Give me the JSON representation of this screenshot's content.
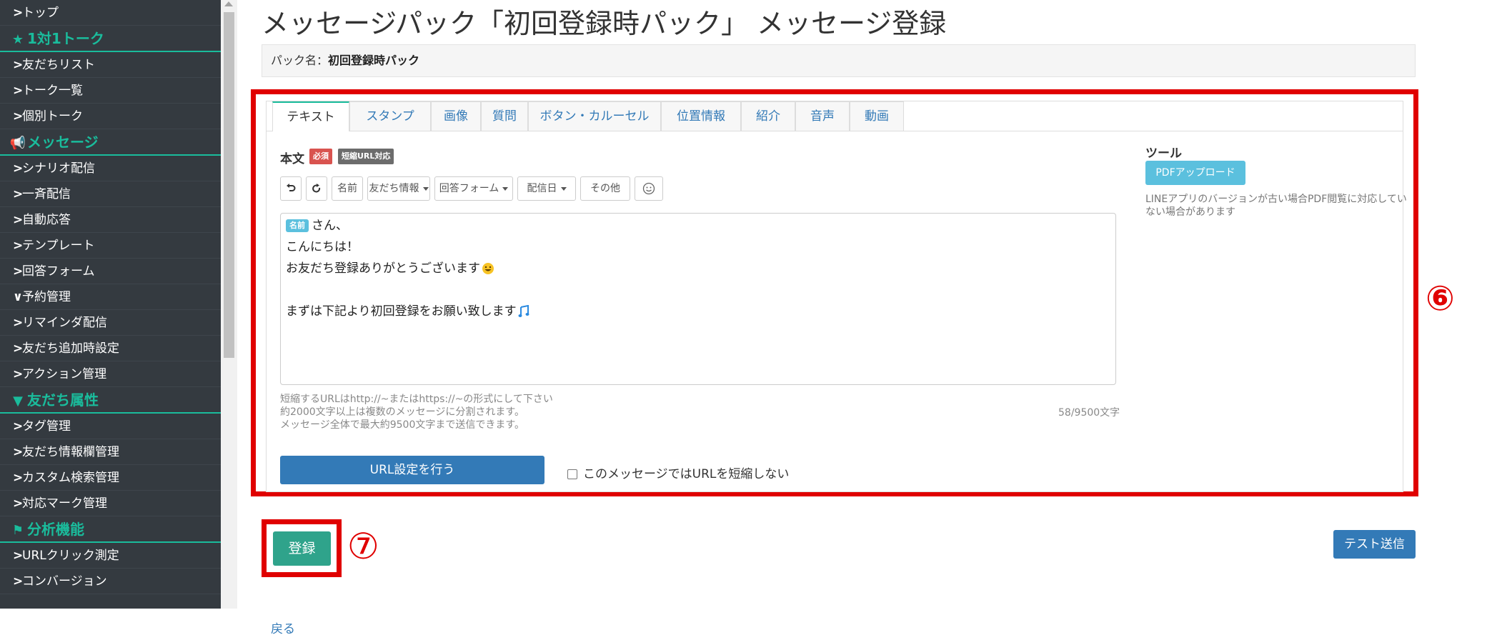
{
  "sidebar": {
    "items": [
      {
        "type": "item",
        "label": "トップ"
      },
      {
        "type": "section",
        "icon": "star-icon",
        "glyph": "★",
        "label": "1対1トーク"
      },
      {
        "type": "item",
        "label": "友だちリスト"
      },
      {
        "type": "item",
        "label": "トーク一覧"
      },
      {
        "type": "item",
        "label": "個別トーク"
      },
      {
        "type": "section",
        "icon": "megaphone-icon",
        "glyph": "📢",
        "label": "メッセージ"
      },
      {
        "type": "item",
        "label": "シナリオ配信"
      },
      {
        "type": "item",
        "label": "一斉配信"
      },
      {
        "type": "item",
        "label": "自動応答"
      },
      {
        "type": "item",
        "label": "テンプレート"
      },
      {
        "type": "item",
        "label": "回答フォーム"
      },
      {
        "type": "item",
        "label": "予約管理",
        "chevron": "∨"
      },
      {
        "type": "item",
        "label": "リマインダ配信"
      },
      {
        "type": "item",
        "label": "友だち追加時設定"
      },
      {
        "type": "item",
        "label": "アクション管理"
      },
      {
        "type": "section",
        "icon": "filter-icon",
        "glyph": "▼",
        "label": "友だち属性"
      },
      {
        "type": "item",
        "label": "タグ管理"
      },
      {
        "type": "item",
        "label": "友だち情報欄管理"
      },
      {
        "type": "item",
        "label": "カスタム検索管理"
      },
      {
        "type": "item",
        "label": "対応マーク管理"
      },
      {
        "type": "section",
        "icon": "flag-icon",
        "glyph": "⚑",
        "label": "分析機能"
      },
      {
        "type": "item",
        "label": "URLクリック測定"
      },
      {
        "type": "item",
        "label": "コンバージョン"
      }
    ]
  },
  "page": {
    "title": "メッセージパック「初回登録時パック」 メッセージ登録",
    "pack_prefix": "パック名：",
    "pack_name": "初回登録時パック"
  },
  "tabs": [
    "テキスト",
    "スタンプ",
    "画像",
    "質問",
    "ボタン・カルーセル",
    "位置情報",
    "紹介",
    "音声",
    "動画"
  ],
  "editor": {
    "label": "本文",
    "badge_required": "必須",
    "badge_url": "短縮URL対応",
    "toolbar": {
      "name": "名前",
      "friend_info": "友だち情報",
      "answer_form": "回答フォーム",
      "delivery_date": "配信日",
      "other": "その他"
    },
    "name_chip": "名前",
    "lines": [
      "さん、",
      "こんにちは！",
      "お友だち登録ありがとうございます",
      "",
      "まずは下記より初回登録をお願い致します"
    ],
    "note1": "短縮するURLはhttp://~またはhttps://~の形式にして下さい",
    "note2": "約2000文字以上は複数のメッセージに分割されます。",
    "note3": "メッセージ全体で最大約9500文字まで送信できます。",
    "count": "58/9500文字",
    "url_button": "URL設定を行う",
    "no_shorten": "このメッセージではURLを短縮しない"
  },
  "tools": {
    "title": "ツール",
    "pdf_button": "PDFアップロード",
    "pdf_note": "LINEアプリのバージョンが古い場合PDF閲覧に対応していない場合があります"
  },
  "actions": {
    "register": "登録",
    "test_send": "テスト送信",
    "back": "戻る"
  },
  "annotations": {
    "panel_marker": "⑥",
    "register_marker": "⑦"
  },
  "colors": {
    "sidebar_bg": "#343a40",
    "accent": "#1abc9c",
    "primary": "#337ab7",
    "highlight": "#e00000",
    "register": "#2fa38b"
  }
}
